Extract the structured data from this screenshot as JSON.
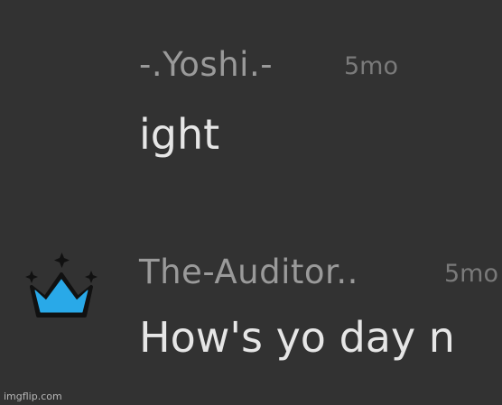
{
  "comments": [
    {
      "username": "-.Yoshi.-",
      "timestamp": "5mo",
      "text": "ight"
    },
    {
      "username": "The-Auditor..",
      "timestamp": "5mo",
      "text": "How's yo day n",
      "avatar_icon": "crown-icon",
      "avatar_color": "#29a9e8"
    }
  ],
  "watermark": "imgflip.com",
  "colors": {
    "background": "#323232",
    "username": "#9a9a9a",
    "timestamp": "#7a7a7a",
    "text": "#e6e6e6"
  }
}
